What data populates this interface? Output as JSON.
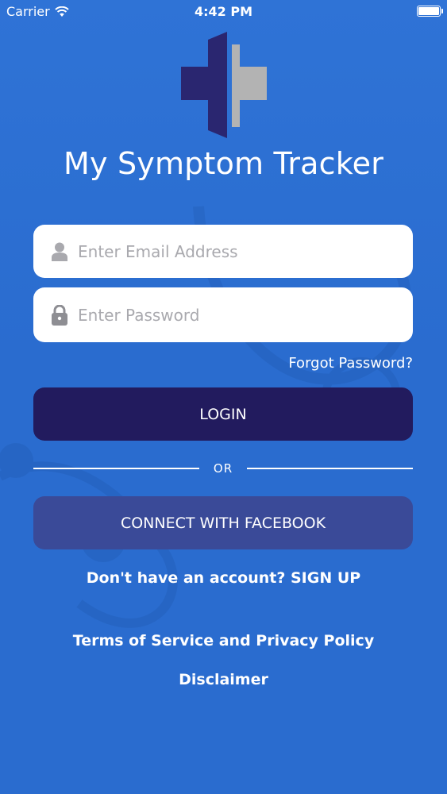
{
  "status_bar": {
    "carrier": "Carrier",
    "time": "4:42 PM"
  },
  "app": {
    "title": "My Symptom Tracker"
  },
  "login_form": {
    "email_placeholder": "Enter Email Address",
    "password_placeholder": "Enter Password",
    "forgot_password": "Forgot Password?",
    "login_label": "LOGIN",
    "or_label": "OR",
    "facebook_label": "CONNECT WITH FACEBOOK"
  },
  "footer": {
    "signup_text": "Don't have an account? SIGN UP",
    "terms_text": "Terms of Service and Privacy Policy",
    "disclaimer_text": "Disclaimer"
  },
  "colors": {
    "background": "#2a6ccf",
    "login_button": "#221b5e",
    "facebook_button": "#3a4a98",
    "logo_dark": "#2a2670",
    "logo_light": "#b3b3b3"
  },
  "icons": {
    "wifi": "wifi-icon",
    "battery": "battery-icon",
    "user": "user-icon",
    "lock": "lock-icon",
    "logo": "medical-cross-logo"
  }
}
